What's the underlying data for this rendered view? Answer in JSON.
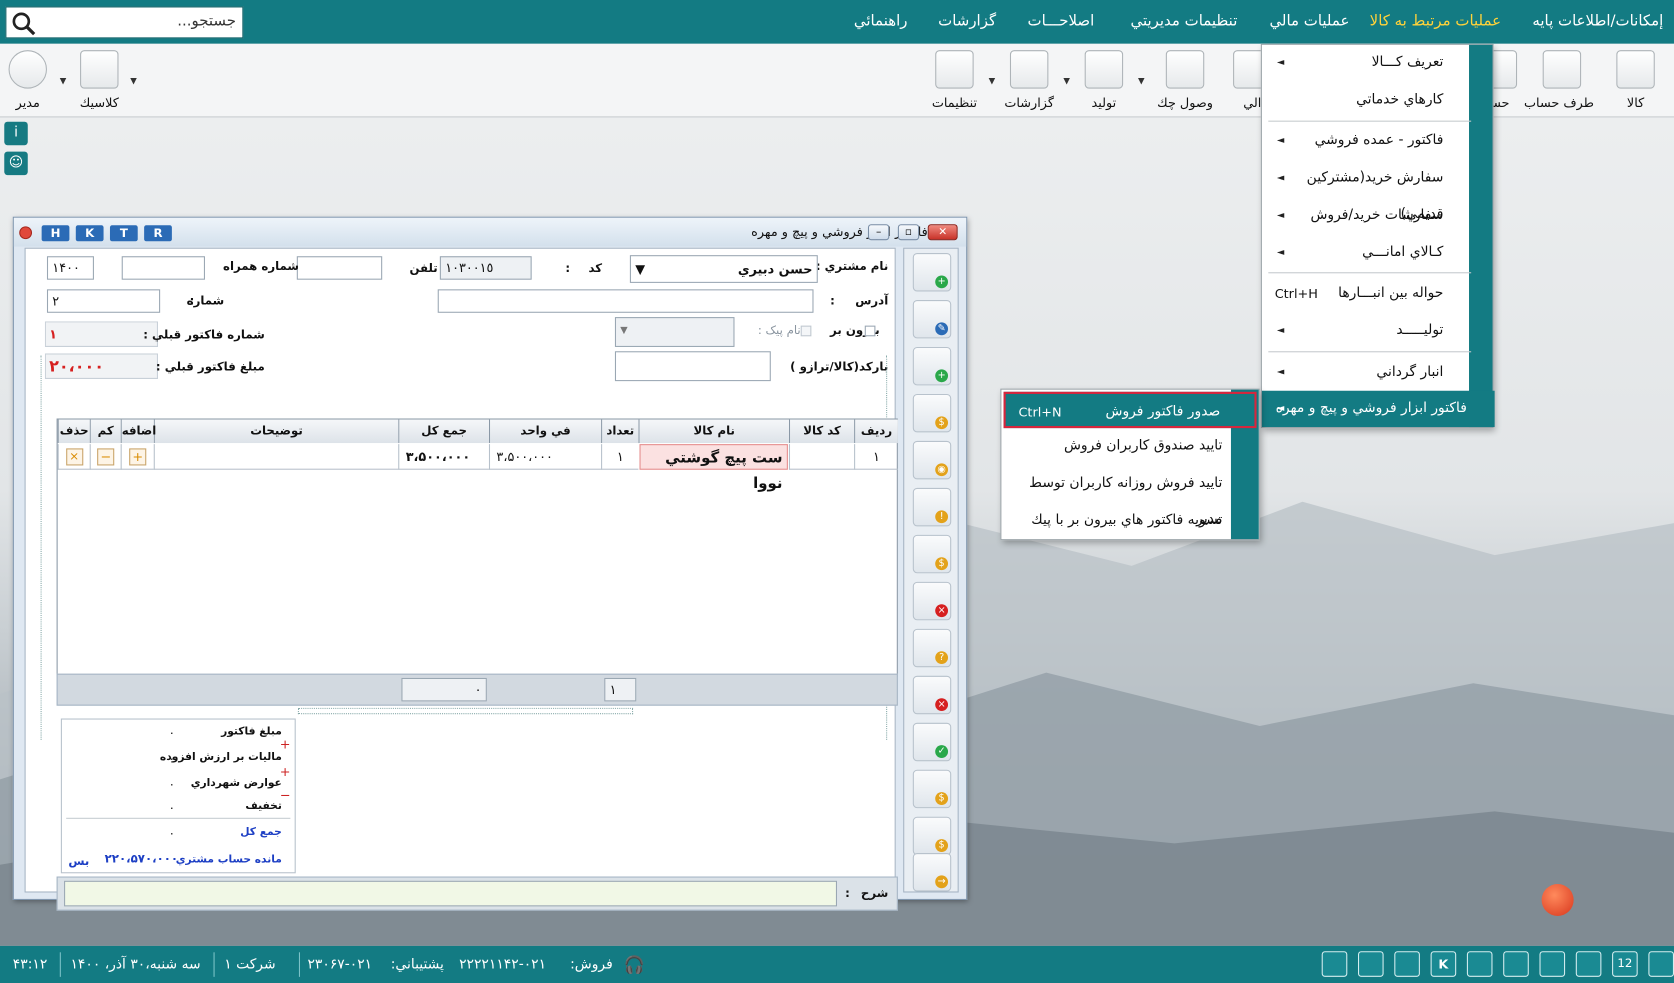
{
  "menubar": {
    "items": [
      "إمكانات/اطلاعات پايه",
      "عمليات مرتبط به كالا",
      "عمليات مالي",
      "تنظيمات مديريتي",
      "اصلاحـــات",
      "گزارشات",
      "راهنمائي"
    ],
    "active_index": 1,
    "search_placeholder": "جستجو..."
  },
  "toolbar": {
    "right_items": [
      "كالا",
      "طرف حساب",
      "حسا",
      "الي",
      "وصول چك",
      "توليد",
      "گزارشات",
      "تنظيمات"
    ],
    "left_items": [
      "كلاسيك",
      "مدير"
    ]
  },
  "main_menu": {
    "items": [
      {
        "label": "تعريف كـــالا",
        "submenu": true,
        "shortcut": ""
      },
      {
        "label": "كارهاي خدماتي",
        "submenu": false,
        "shortcut": ""
      },
      {
        "label": "فاكتور - عمده فروشي",
        "submenu": true,
        "shortcut": ""
      },
      {
        "label": "سفارش خريد(مشتركين قديمي)",
        "submenu": true,
        "shortcut": ""
      },
      {
        "label": "سفارشات خريد/فروش",
        "submenu": true,
        "shortcut": ""
      },
      {
        "label": "كـالاي امانـــي",
        "submenu": true,
        "shortcut": ""
      },
      {
        "label": "حواله بين انبـــارها",
        "submenu": false,
        "shortcut": "Ctrl+H"
      },
      {
        "label": "توليـــــد",
        "submenu": true,
        "shortcut": ""
      },
      {
        "label": "انبار گرداني",
        "submenu": true,
        "shortcut": ""
      },
      {
        "label": "فاكتور ابزار فروشي و پيچ و مهره",
        "submenu": true,
        "shortcut": ""
      }
    ],
    "selected_index": 9
  },
  "sub_menu": {
    "items": [
      {
        "label": "صدور فاكتور فروش",
        "shortcut": "Ctrl+N"
      },
      {
        "label": "تاييد صندوق كاربران فروش",
        "shortcut": ""
      },
      {
        "label": "تاييد فروش روزانه كاربران توسط مدير",
        "shortcut": ""
      },
      {
        "label": "تسويه فاكتور هاي بيرون بر با پيك",
        "shortcut": ""
      }
    ],
    "selected_index": 0
  },
  "window": {
    "title": "فاكتور ابزار فروشي و پيچ و مهره",
    "hk_buttons": [
      "H",
      "K",
      "T",
      "R"
    ]
  },
  "form": {
    "customer_label": "نام مشتري :",
    "customer_value": "حسن دبيري",
    "code_label": "كد",
    "code_value": "١٠٣٠٠١٥",
    "phone_label": "تلفن",
    "phone_value": "",
    "mobile_label": "شماره همراه",
    "mobile_value": "",
    "year_value": "١۴٠٠",
    "address_label": "آدرس",
    "address_value": "",
    "number_label": "شماره",
    "number_value": "٢",
    "prev_invoice_label": "شماره فاكتور قبلي :",
    "prev_invoice_value": "١",
    "prev_amount_label": "مبلغ فاكتور قبلي :",
    "prev_amount_value": "٢٠،٠٠٠",
    "outside_label": "بيرون بر",
    "courier_label": "نام پيک :",
    "barcode_label": "باركد(كالا/ترازو )",
    "barcode_value": ""
  },
  "grid": {
    "columns": [
      "رديف",
      "كد كالا",
      "نام كالا",
      "تعداد",
      "في واحد",
      "جمع كل",
      "توضيحات",
      "اضافه",
      "كم",
      "حذف"
    ],
    "rows": [
      {
        "row": "١",
        "code": "",
        "name": "ست پيچ گوشتي نووا",
        "qty": "١",
        "unit": "٣،۵٠٠،٠٠٠",
        "total": "٣،۵٠٠،٠٠٠",
        "desc": ""
      }
    ],
    "footer_count": "١",
    "footer_sum": "٠"
  },
  "totals": {
    "labels": [
      "مبلغ فاكتور",
      "ماليات بر ارزش افزوده",
      "عوارض شهرداري",
      "تخفيف",
      "جمع كل",
      "مانده حساب مشتري"
    ],
    "values": [
      "٠",
      "٠",
      "٠",
      "٠",
      "٠",
      "٢٢٠،۵٧٠،٠٠٠"
    ],
    "balance_status": "بس"
  },
  "sharh_label": "شرح",
  "statusbar": {
    "sales_label": "فروش:",
    "sales_phone": "٠٢١-٢٢٢٢١١۴٢",
    "support_label": "پشتيباني:",
    "support_phone": "٠٢١-٢٣٠۶٧",
    "company": "شركت ١",
    "date": "سه شنبه،٣٠ آذر، ١۴٠٠",
    "time": "١٢:۴٣"
  },
  "colors": {
    "teal": "#137b83",
    "active_menu": "#ffd23a",
    "highlight_border": "#d7263d"
  }
}
